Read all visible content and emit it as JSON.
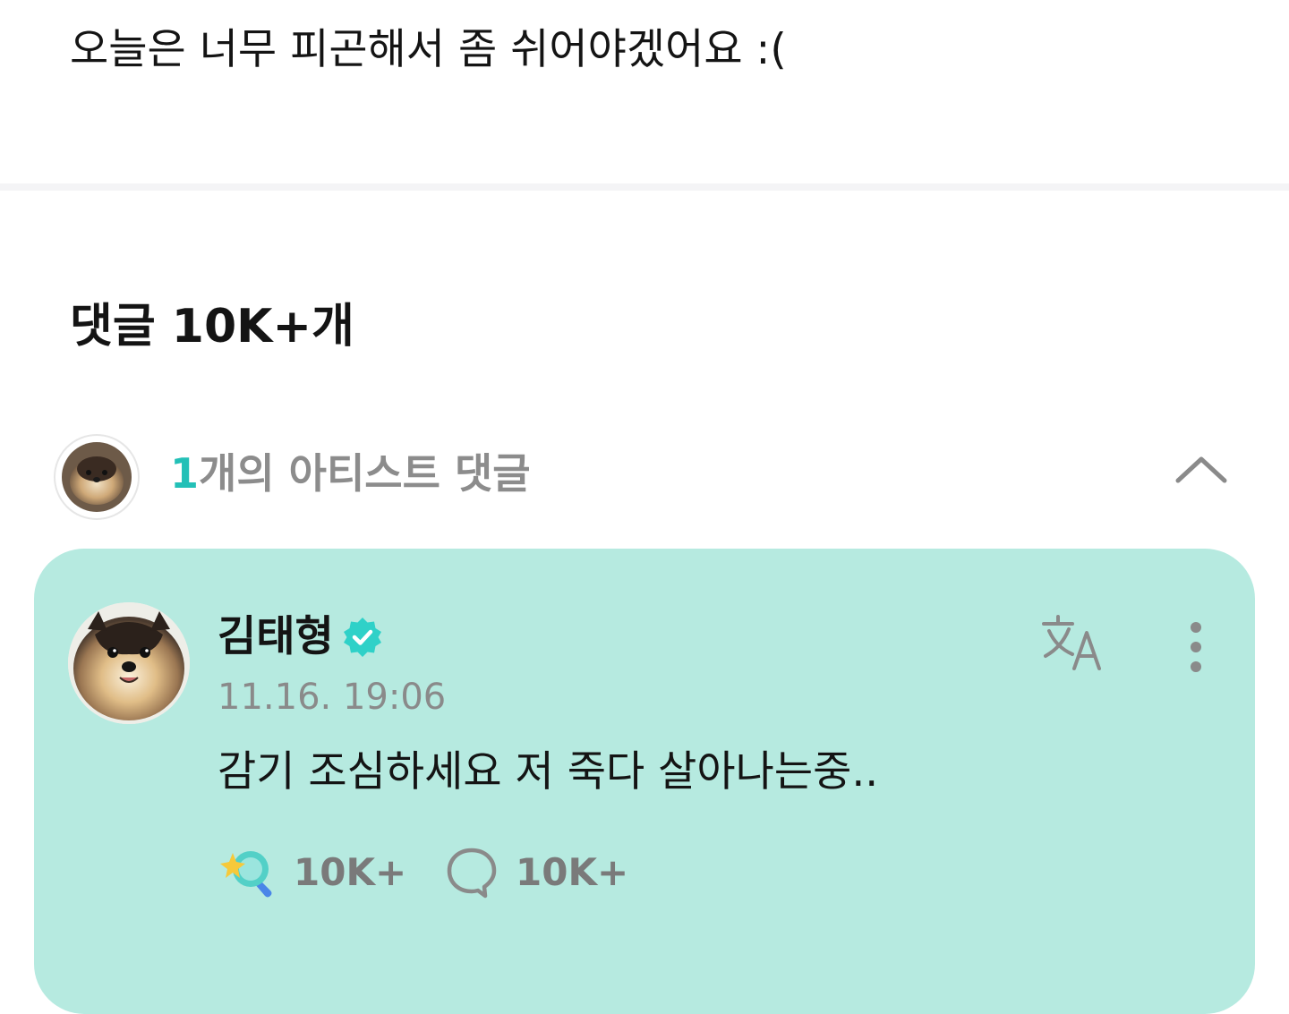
{
  "post": {
    "text": "오늘은 너무 피곤해서 좀 쉬어야겠어요 :("
  },
  "comments_section": {
    "heading": "댓글 10K+개",
    "artist_summary": {
      "count": "1",
      "label": "개의 아티스트 댓글",
      "avatar_icon": "pomeranian-avatar-icon",
      "toggle_icon": "chevron-up-icon"
    }
  },
  "artist_comment": {
    "author": "김태형",
    "verified_icon": "verified-badge-icon",
    "timestamp": "11.16. 19:06",
    "body": "감기 조심하세요 저 죽다 살아나는중..",
    "actions": {
      "translate_icon": "translate-icon",
      "more_icon": "more-vertical-icon"
    },
    "reactions": {
      "like_count": "10K+",
      "like_icon": "cheer-sparkle-icon",
      "reply_count": "10K+",
      "reply_icon": "comment-bubble-icon"
    }
  },
  "colors": {
    "accent": "#23c0b7",
    "card_background": "#b6eae0",
    "verified": "#2fd1c8",
    "muted_text": "#8a8a8a"
  }
}
